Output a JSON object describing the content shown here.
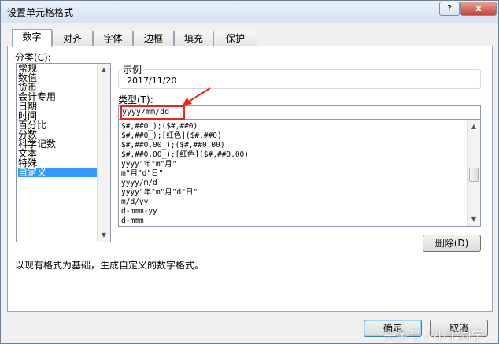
{
  "window": {
    "title": "设置单元格格式",
    "help_label": "?",
    "close_label": "x"
  },
  "tabs": [
    {
      "label": "数字",
      "active": true
    },
    {
      "label": "对齐",
      "active": false
    },
    {
      "label": "字体",
      "active": false
    },
    {
      "label": "边框",
      "active": false
    },
    {
      "label": "填充",
      "active": false
    },
    {
      "label": "保护",
      "active": false
    }
  ],
  "category": {
    "label": "分类(C):",
    "items": [
      "常规",
      "数值",
      "货币",
      "会计专用",
      "日期",
      "时间",
      "百分比",
      "分数",
      "科学记数",
      "文本",
      "特殊",
      "自定义"
    ],
    "selected": "自定义"
  },
  "sample": {
    "label": "示例",
    "value": "2017/11/20"
  },
  "type": {
    "label": "类型(T):",
    "value": "yyyy/mm/dd",
    "formats": [
      "$#,##0_);($#,##0)",
      "$#,##0_);[红色]($#,##0)",
      "$#,##0.00_);($#,##0.00)",
      "$#,##0.00_);[红色]($#,##0.00)",
      "yyyy\"年\"m\"月\"",
      "m\"月\"d\"日\"",
      "yyyy/m/d",
      "yyyy\"年\"m\"月\"d\"日\"",
      "m/d/yy",
      "d-mmm-yy",
      "d-mmm"
    ]
  },
  "delete_button": "删除(D)",
  "description": "以现有格式为基础，生成自定义的数字格式。",
  "footer": {
    "ok": "确定",
    "cancel": "取消"
  },
  "watermark": "头条号 / 小于同学",
  "colors": {
    "highlight": "#e8261c",
    "selection": "#3399ff",
    "default_button_border": "#3c7fb1"
  }
}
